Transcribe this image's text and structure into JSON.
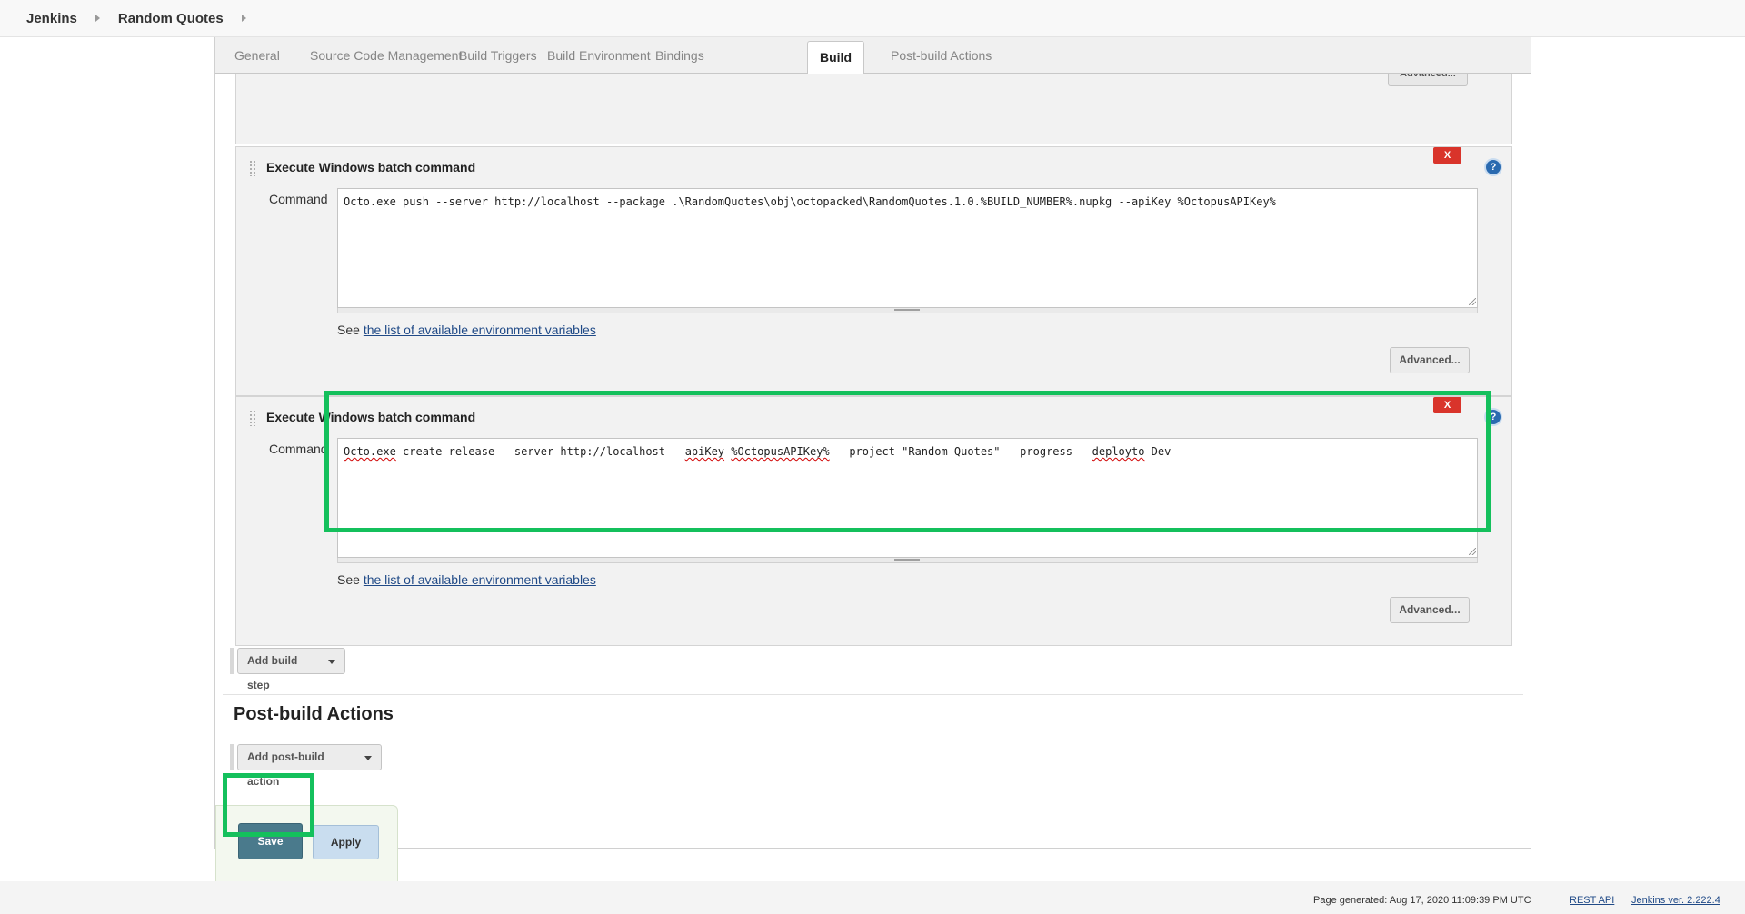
{
  "breadcrumb": {
    "items": [
      "Jenkins",
      "Random Quotes"
    ]
  },
  "tabs": [
    "General",
    "Source Code Management",
    "Build Triggers",
    "Build Environment",
    "Bindings",
    "Build",
    "Post-build Actions"
  ],
  "active_tab": "Build",
  "prev_section": {
    "advanced_label": "Advanced..."
  },
  "steps": [
    {
      "title": "Execute Windows batch command",
      "delete_label": "X",
      "help_label": "?",
      "command_label": "Command",
      "command": "Octo.exe push --server http://localhost --package .\\RandomQuotes\\obj\\octopacked\\RandomQuotes.1.0.%BUILD_NUMBER%.nupkg --apiKey %OctopusAPIKey%",
      "see_prefix": "See",
      "see_link": "the list of available environment variables",
      "advanced_label": "Advanced..."
    },
    {
      "title": "Execute Windows batch command",
      "delete_label": "X",
      "help_label": "?",
      "command_label": "Command",
      "command_parts": [
        "Octo.exe",
        " create-release --server http://localhost --",
        "apiKey",
        " ",
        "%OctopusAPIKey%",
        " --project \"Random Quotes\" --progress --",
        "deployto",
        " Dev"
      ],
      "see_prefix": "See",
      "see_link": "the list of available environment variables",
      "advanced_label": "Advanced..."
    }
  ],
  "add_build_step_label": "Add build step",
  "post_build": {
    "heading": "Post-build Actions",
    "add_label": "Add post-build action"
  },
  "buttons": {
    "save": "Save",
    "apply": "Apply"
  },
  "footer": {
    "generated": "Page generated: Aug 17, 2020 11:09:39 PM UTC",
    "rest_api": "REST API",
    "version": "Jenkins ver. 2.222.4"
  },
  "colors": {
    "highlight": "#14c05c",
    "delete": "#d9342b",
    "save": "#4a7a8c",
    "apply": "#c9ddef",
    "link": "#204a87"
  }
}
